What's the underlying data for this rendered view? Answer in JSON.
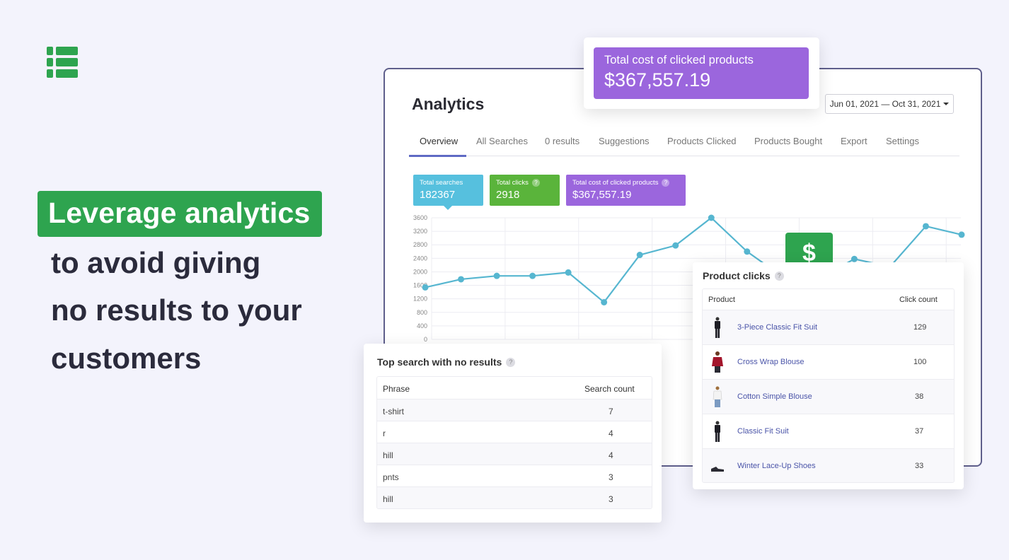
{
  "colors": {
    "brand_green": "#2ea44f",
    "searches": "#56c0de",
    "clicks": "#5ab43b",
    "cost": "#9b66dd",
    "line": "#56b6d0"
  },
  "hero": {
    "headline": "Leverage analytics",
    "lines": [
      "to avoid giving",
      "no results to your",
      "customers"
    ]
  },
  "popup": {
    "label": "Total cost of clicked products",
    "value": "$367,557.19"
  },
  "analytics": {
    "title": "Analytics",
    "date_range": "Jun 01, 2021 — Oct 31, 2021",
    "tabs": [
      "Overview",
      "All Searches",
      "0 results",
      "Suggestions",
      "Products Clicked",
      "Products Bought",
      "Export",
      "Settings"
    ],
    "active_tab": "Overview",
    "stats": [
      {
        "label": "Total searches",
        "value": "182367",
        "help": ""
      },
      {
        "label": "Total clicks",
        "value": "2918",
        "help": "?"
      },
      {
        "label": "Total cost of clicked products",
        "value": "$367,557.19",
        "help": "?"
      }
    ]
  },
  "chart_data": {
    "type": "line",
    "title": "",
    "xlabel": "",
    "ylabel": "",
    "ylim": [
      0,
      3600
    ],
    "yticks": [
      "3600",
      "3200",
      "2800",
      "2400",
      "2000",
      "1600",
      "1200",
      "800",
      "400",
      "0"
    ],
    "grid": true,
    "series": [
      {
        "values": [
          1540,
          1780,
          1880,
          1880,
          1980,
          1100,
          2500,
          2780,
          3600,
          2600,
          1850,
          1800,
          2380,
          2150,
          3350,
          3100
        ]
      }
    ]
  },
  "dollar_icon": "$",
  "no_results": {
    "title": "Top search with no results",
    "help": "?",
    "columns": [
      "Phrase",
      "Search count"
    ],
    "rows": [
      {
        "phrase": "t-shirt",
        "count": "7"
      },
      {
        "phrase": "r",
        "count": "4"
      },
      {
        "phrase": "hill",
        "count": "4"
      },
      {
        "phrase": "pnts",
        "count": "3"
      },
      {
        "phrase": "hill",
        "count": "3"
      }
    ]
  },
  "product_clicks": {
    "title": "Product clicks",
    "help": "?",
    "columns": [
      "Product",
      "Click count"
    ],
    "rows": [
      {
        "name": "3-Piece Classic Fit Suit",
        "count": "129",
        "thumb": "suit-image"
      },
      {
        "name": "Cross Wrap Blouse",
        "count": "100",
        "thumb": "blouse-image"
      },
      {
        "name": "Cotton Simple Blouse",
        "count": "38",
        "thumb": "white-blouse-image"
      },
      {
        "name": "Classic Fit Suit",
        "count": "37",
        "thumb": "suit-image"
      },
      {
        "name": "Winter Lace-Up Shoes",
        "count": "33",
        "thumb": "shoe-image"
      }
    ]
  }
}
